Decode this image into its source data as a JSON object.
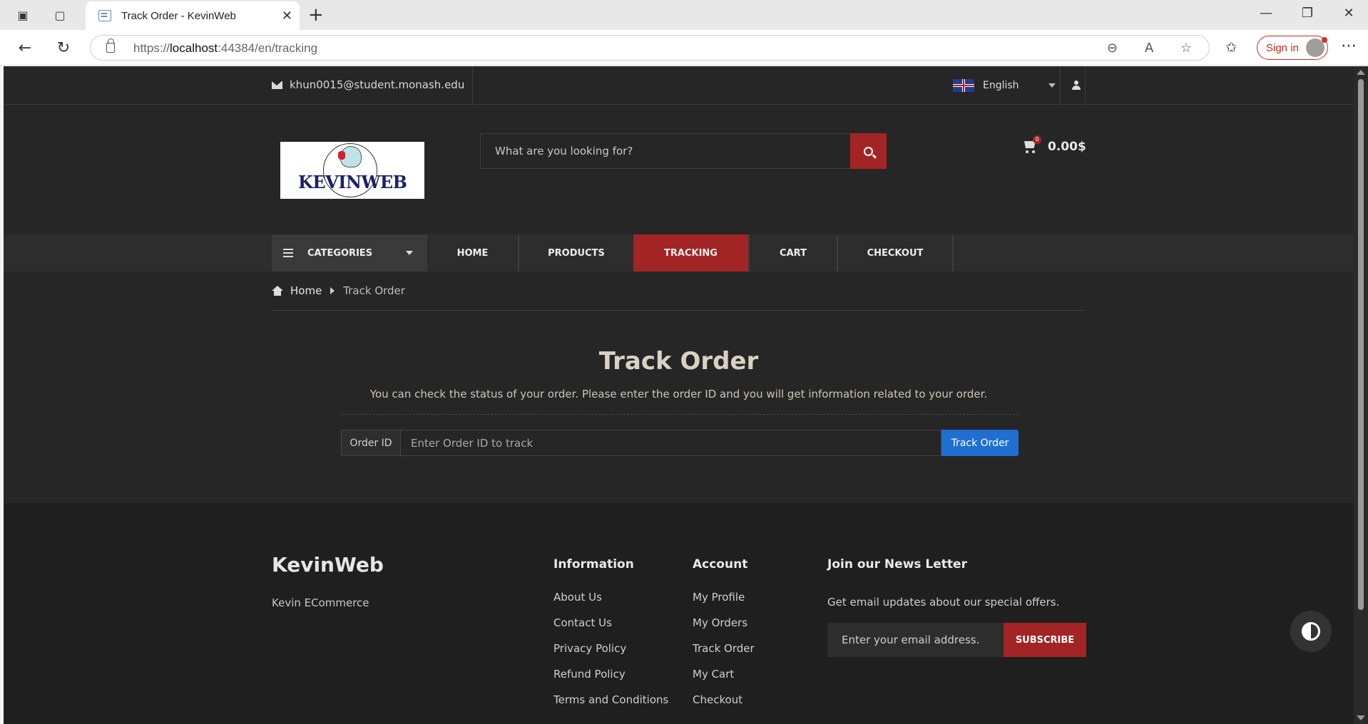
{
  "browser": {
    "tab_title": "Track Order - KevinWeb",
    "url_prefix": "https://",
    "url_host": "localhost",
    "url_rest": ":44384/en/tracking",
    "signin_label": "Sign in"
  },
  "topbar": {
    "email": "khun0015@student.monash.edu",
    "language": "English"
  },
  "header": {
    "logo_text": "KEVINWEB",
    "search_placeholder": "What are you looking for?",
    "cart_count": "0",
    "cart_total": "0.00$"
  },
  "nav": {
    "categories_label": "CATEGORIES",
    "items": [
      "HOME",
      "PRODUCTS",
      "TRACKING",
      "CART",
      "CHECKOUT"
    ],
    "active": "TRACKING"
  },
  "breadcrumb": {
    "home": "Home",
    "current": "Track Order"
  },
  "track": {
    "title": "Track Order",
    "description": "You can check the status of your order. Please enter the order ID and you will get information related to your order.",
    "order_label": "Order ID",
    "order_placeholder": "Enter Order ID to track",
    "button": "Track Order"
  },
  "footer": {
    "brand": "KevinWeb",
    "tagline": "Kevin ECommerce",
    "information": {
      "title": "Information",
      "links": [
        "About Us",
        "Contact Us",
        "Privacy Policy",
        "Refund Policy",
        "Terms and Conditions"
      ]
    },
    "account": {
      "title": "Account",
      "links": [
        "My Profile",
        "My Orders",
        "Track Order",
        "My Cart",
        "Checkout"
      ]
    },
    "newsletter": {
      "title": "Join our News Letter",
      "description": "Get email updates about our special offers.",
      "placeholder": "Enter your email address.",
      "button": "SUBSCRIBE"
    }
  },
  "colors": {
    "accent": "#a32424",
    "primary_button": "#1f6fd1",
    "background": "#262626",
    "footer_bg": "#1f1f1f"
  }
}
